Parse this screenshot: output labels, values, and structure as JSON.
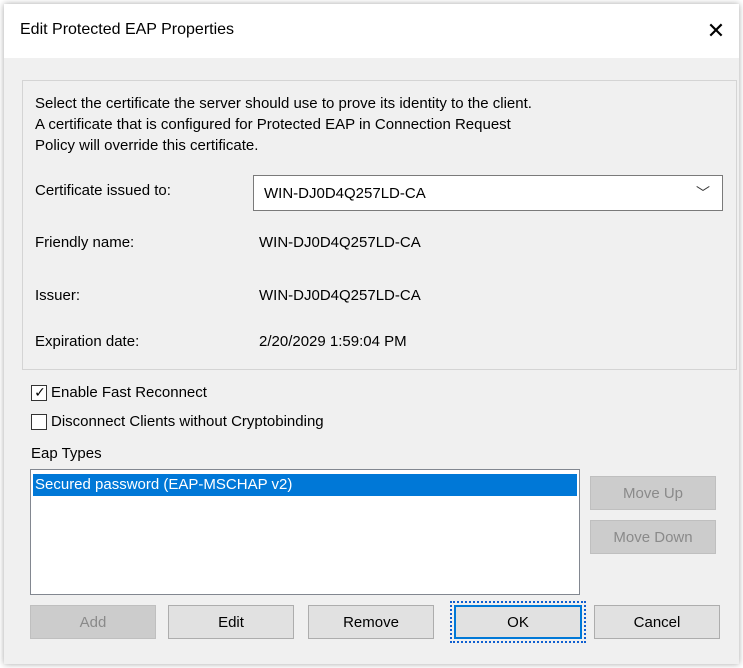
{
  "dialog": {
    "title": "Edit Protected EAP Properties",
    "close_glyph": "✕"
  },
  "certificate": {
    "description_line1": "Select the certificate the server should use to prove its identity to the client.",
    "description_line2": "A certificate that is configured for Protected EAP in Connection Request",
    "description_line3": "Policy will override this certificate.",
    "issued_to_label": "Certificate issued to:",
    "issued_to_value": "WIN-DJ0D4Q257LD-CA",
    "friendly_name_label": "Friendly name:",
    "friendly_name_value": "WIN-DJ0D4Q257LD-CA",
    "issuer_label": "Issuer:",
    "issuer_value": "WIN-DJ0D4Q257LD-CA",
    "expiration_label": "Expiration date:",
    "expiration_value": "2/20/2029 1:59:04 PM"
  },
  "options": {
    "fast_reconnect_label": "Enable Fast Reconnect",
    "fast_reconnect_checked": true,
    "cryptobinding_label": "Disconnect Clients without Cryptobinding",
    "cryptobinding_checked": false
  },
  "eap_types": {
    "label": "Eap Types",
    "items": [
      "Secured password (EAP-MSCHAP v2)"
    ],
    "move_up": "Move Up",
    "move_down": "Move Down"
  },
  "buttons": {
    "add": "Add",
    "edit": "Edit",
    "remove": "Remove",
    "ok": "OK",
    "cancel": "Cancel"
  },
  "icons": {
    "checkmark": "✓",
    "chevron": "﹀"
  },
  "colors": {
    "selection": "#0078d7",
    "focus": "#1060d0"
  }
}
